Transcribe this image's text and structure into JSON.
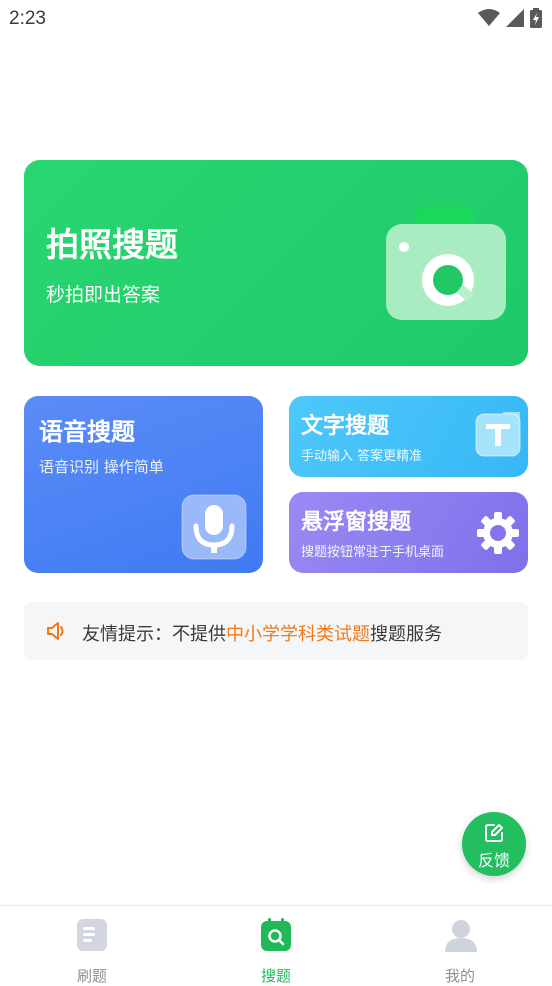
{
  "status_bar": {
    "time": "2:23"
  },
  "cards": {
    "photo": {
      "title": "拍照搜题",
      "subtitle": "秒拍即出答案"
    },
    "voice": {
      "title": "语音搜题",
      "subtitle": "语音识别 操作简单"
    },
    "text": {
      "title": "文字搜题",
      "subtitle": "手动输入 答案更精准"
    },
    "float": {
      "title": "悬浮窗搜题",
      "subtitle": "搜题按钮常驻于手机桌面"
    }
  },
  "notice": {
    "prefix": "友情提示：不提供",
    "highlight": "中小学学科类试题",
    "suffix": "搜题服务"
  },
  "feedback": {
    "label": "反馈"
  },
  "nav": {
    "items": [
      {
        "label": "刷题",
        "icon": "document-icon"
      },
      {
        "label": "搜题",
        "icon": "search-icon",
        "active": true
      },
      {
        "label": "我的",
        "icon": "user-icon"
      }
    ]
  },
  "colors": {
    "green": "#21b85a",
    "blue": "#3f7af2",
    "cyan": "#36b7f6",
    "purple": "#7d70ea",
    "highlight": "#f07a1a"
  }
}
